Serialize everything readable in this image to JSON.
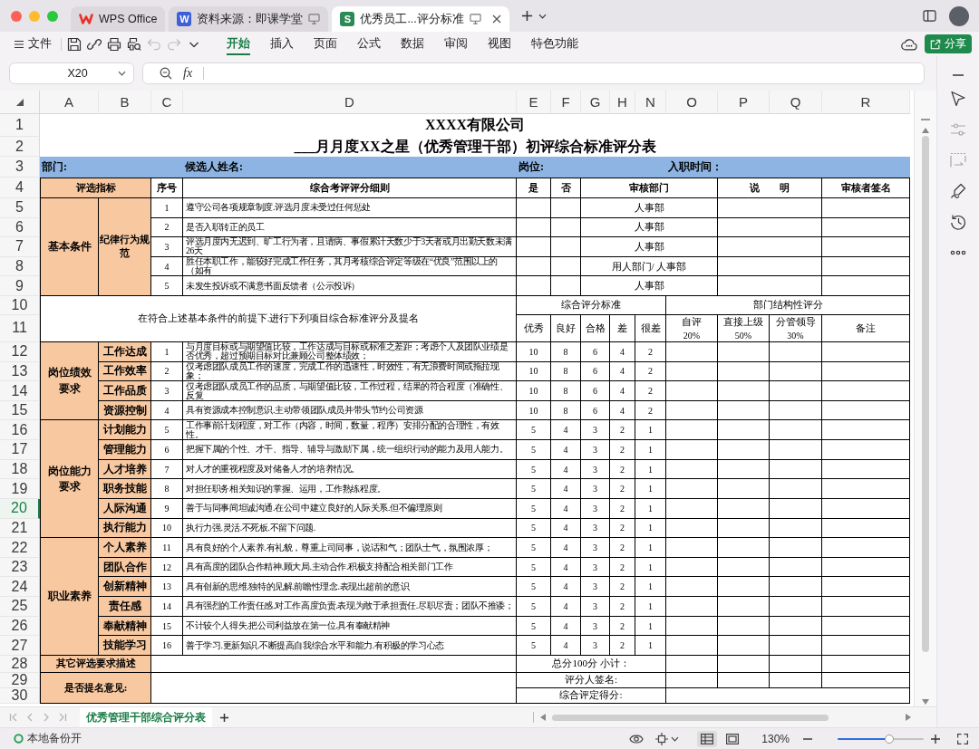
{
  "window": {
    "tabs": [
      {
        "label": "WPS Office",
        "kind": "home",
        "selected": false
      },
      {
        "label": "资料来源：即课学堂",
        "kind": "doc",
        "badge": "W",
        "selected": false
      },
      {
        "label": "优秀员工...评分标准",
        "kind": "sheet",
        "badge": "S",
        "selected": true
      }
    ]
  },
  "toolbar": {
    "file_menu": "文件",
    "quick_actions": [
      {
        "kind": "save",
        "disabled": false
      },
      {
        "kind": "link",
        "disabled": false
      },
      {
        "kind": "print",
        "disabled": false
      },
      {
        "kind": "preview",
        "disabled": false
      },
      {
        "kind": "undo",
        "disabled": true
      },
      {
        "kind": "redo",
        "disabled": true
      },
      {
        "kind": "more",
        "disabled": false
      }
    ],
    "ribbon_tabs": [
      {
        "label": "开始",
        "selected": true
      },
      {
        "label": "插入",
        "selected": false
      },
      {
        "label": "页面",
        "selected": false
      },
      {
        "label": "公式",
        "selected": false
      },
      {
        "label": "数据",
        "selected": false
      },
      {
        "label": "审阅",
        "selected": false
      },
      {
        "label": "视图",
        "selected": false
      },
      {
        "label": "特色功能",
        "selected": false
      }
    ],
    "share_button": "分享"
  },
  "formula_bar": {
    "name_box": "X20",
    "function_label": "fx"
  },
  "sheet": {
    "columns": [
      "A",
      "B",
      "C",
      "D",
      "E",
      "F",
      "G",
      "H",
      "N",
      "O",
      "P",
      "Q",
      "R"
    ],
    "rows": [
      {
        "label": "1",
        "selected": false
      },
      {
        "label": "2",
        "selected": false
      },
      {
        "label": "3",
        "selected": false
      },
      {
        "label": "4",
        "selected": false
      },
      {
        "label": "5",
        "selected": false
      },
      {
        "label": "6",
        "selected": false
      },
      {
        "label": "7",
        "selected": false
      },
      {
        "label": "8",
        "selected": false
      },
      {
        "label": "9",
        "selected": false
      },
      {
        "label": "10",
        "selected": false
      },
      {
        "label": "11",
        "selected": false
      },
      {
        "label": "12",
        "selected": false
      },
      {
        "label": "13",
        "selected": false
      },
      {
        "label": "14",
        "selected": false
      },
      {
        "label": "15",
        "selected": false
      },
      {
        "label": "16",
        "selected": false
      },
      {
        "label": "17",
        "selected": false
      },
      {
        "label": "18",
        "selected": false
      },
      {
        "label": "19",
        "selected": false
      },
      {
        "label": "20",
        "selected": true
      },
      {
        "label": "21",
        "selected": false
      },
      {
        "label": "22",
        "selected": false
      },
      {
        "label": "23",
        "selected": false
      },
      {
        "label": "24",
        "selected": false
      },
      {
        "label": "25",
        "selected": false
      },
      {
        "label": "26",
        "selected": false
      },
      {
        "label": "27",
        "selected": false
      },
      {
        "label": "28",
        "selected": false
      },
      {
        "label": "29",
        "selected": false
      },
      {
        "label": "30",
        "selected": false
      }
    ],
    "title": "XXXX有限公司",
    "subtitle": "___月月度XX之星（优秀管理干部）初评综合标准评分表",
    "info_fields": [
      "部门:",
      "候选人姓名:",
      "岗位:",
      "入职时间："
    ],
    "header": [
      "评选指标",
      "序号",
      "综合考评评分细则",
      "是",
      "否",
      "审核部门",
      "说　　明",
      "审核者签名"
    ],
    "basic": {
      "category": "基本条件",
      "subcategory": "纪律行为规范",
      "items": [
        {
          "number": "1",
          "text": "遵守公司各项规章制度.评选月度未受过任何惩处",
          "department": "人事部"
        },
        {
          "number": "2",
          "text": "是否入职转正的员工",
          "department": "人事部"
        },
        {
          "number": "3",
          "text": "评选月度内无迟到、旷工行为者，且请病、事假累计天数少于3天者或月出勤天数未满26天",
          "department": "人事部"
        },
        {
          "number": "4",
          "text": "胜任本职工作，能较好完成工作任务，其月考核综合评定等级在“优良”范围以上的（如有",
          "department": "用人部门/ 人事部"
        },
        {
          "number": "5",
          "text": "未发生投诉或不满意书面反馈者（公示投诉）",
          "department": "人事部"
        }
      ]
    },
    "scoring_intro": "在符合上述基本条件的前提下.进行下列项目综合标准评分及提名",
    "standard_heading": "综合评分标准",
    "grades": [
      "优秀",
      "良好",
      "合格",
      "差",
      "很差"
    ],
    "structure_heading": "部门结构性评分",
    "raters": [
      {
        "label": "自评",
        "weight": "20%"
      },
      {
        "label": "直接上级",
        "weight": "50%"
      },
      {
        "label": "分管领导",
        "weight": "30%"
      }
    ],
    "remarks": "备注",
    "groups": [
      {
        "category": "岗位绩效要求",
        "items": [
          {
            "name": "工作达成",
            "number": "1",
            "text": "与月度目标或与期望值比较，工作达成与目标或标准之差距；考虑个人及团队业绩是否优秀，超过预期目标对比兼顾公司整体绩效；",
            "scores": [
              "10",
              "8",
              "6",
              "4",
              "2"
            ]
          },
          {
            "name": "工作效率",
            "number": "2",
            "text": "仅考虑团队成员工作的速度，完成工作的迅速性，时效性，有无浪费时间或拖拉现象；",
            "scores": [
              "10",
              "8",
              "6",
              "4",
              "2"
            ]
          },
          {
            "name": "工作品质",
            "number": "3",
            "text": "仅考虑团队成员工作的品质，与期望值比较，工作过程，结果的符合程度（准确性、反复",
            "scores": [
              "10",
              "8",
              "6",
              "4",
              "2"
            ]
          },
          {
            "name": "资源控制",
            "number": "4",
            "text": "具有资源成本控制意识.主动带领团队成员并带头节约公司资源",
            "scores": [
              "10",
              "8",
              "6",
              "4",
              "2"
            ]
          }
        ]
      },
      {
        "category": "岗位能力要求",
        "items": [
          {
            "name": "计划能力",
            "number": "5",
            "text": "工作事前计划程度，对工作（内容，时间，数量，程序）安排分配的合理性，有效性。",
            "scores": [
              "5",
              "4",
              "3",
              "2",
              "1"
            ]
          },
          {
            "name": "管理能力",
            "number": "6",
            "text": "把握下属的个性、才干、指导、辅导与激励下属，统一组织行动的能力及用人能力。",
            "scores": [
              "5",
              "4",
              "3",
              "2",
              "1"
            ]
          },
          {
            "name": "人才培养",
            "number": "7",
            "text": "对人才的重视程度及对储备人才的培养情况。",
            "scores": [
              "5",
              "4",
              "3",
              "2",
              "1"
            ]
          },
          {
            "name": "职务技能",
            "number": "8",
            "text": "对担任职务相关知识的掌握、运用，工作熟练程度。",
            "scores": [
              "5",
              "4",
              "3",
              "2",
              "1"
            ]
          },
          {
            "name": "人际沟通",
            "number": "9",
            "text": "善于与同事间坦诚沟通.在公司中建立良好的人际关系.但不偏理原则",
            "scores": [
              "5",
              "4",
              "3",
              "2",
              "1"
            ]
          },
          {
            "name": "执行能力",
            "number": "10",
            "text": "执行力强.灵活.不死板.不留下问题.",
            "scores": [
              "5",
              "4",
              "3",
              "2",
              "1"
            ]
          }
        ]
      },
      {
        "category": "职业素养",
        "items": [
          {
            "name": "个人素养",
            "number": "11",
            "text": "具有良好的个人素养.有礼貌，尊重上司同事，说话和气；团队士气，氛围浓厚；",
            "scores": [
              "5",
              "4",
              "3",
              "2",
              "1"
            ]
          },
          {
            "name": "团队合作",
            "number": "12",
            "text": "具有高度的团队合作精神.顾大局.主动合作.积极支持配合相关部门工作",
            "scores": [
              "5",
              "4",
              "3",
              "2",
              "1"
            ]
          },
          {
            "name": "创新精神",
            "number": "13",
            "text": "具有创新的思维.独特的见解.前瞻性理念.表现出超前的意识",
            "scores": [
              "5",
              "4",
              "3",
              "2",
              "1"
            ]
          },
          {
            "name": "责任感",
            "number": "14",
            "text": "具有强烈的工作责任感.对工作高度负责.表现为敢于承担责任.尽职尽责；团队不推诿；",
            "scores": [
              "5",
              "4",
              "3",
              "2",
              "1"
            ]
          },
          {
            "name": "奉献精神",
            "number": "15",
            "text": "不计较个人得失.把公司利益放在第一位.具有奉献精神",
            "scores": [
              "5",
              "4",
              "3",
              "2",
              "1"
            ]
          },
          {
            "name": "技能学习",
            "number": "16",
            "text": "善于学习.更新知识.不断提高自我综合水平和能力.有积极的学习心态",
            "scores": [
              "5",
              "4",
              "3",
              "2",
              "1"
            ]
          }
        ]
      }
    ],
    "footer": {
      "other_requirements": "其它评选要求描述",
      "nomination": "是否提名意见:",
      "total": "总分100分 小计：",
      "rater_signature": "评分人签名:",
      "final_score": "综合评定得分:"
    }
  },
  "sheet_tabs": [
    {
      "label": "优秀管理干部综合评分表",
      "selected": true
    }
  ],
  "side_tools": [
    {
      "kind": "cursor",
      "disabled": false
    },
    {
      "kind": "sliders",
      "disabled": true
    },
    {
      "kind": "frame",
      "disabled": true
    },
    {
      "kind": "signature",
      "disabled": false
    },
    {
      "kind": "history",
      "disabled": false
    },
    {
      "kind": "more",
      "disabled": false
    }
  ],
  "status_bar": {
    "backup": "本地备份开",
    "view_modes": [
      {
        "kind": "normal",
        "selected": true
      },
      {
        "kind": "page",
        "selected": false
      }
    ],
    "zoom": "130%",
    "zoom_slider": {
      "level": 0.6
    }
  }
}
